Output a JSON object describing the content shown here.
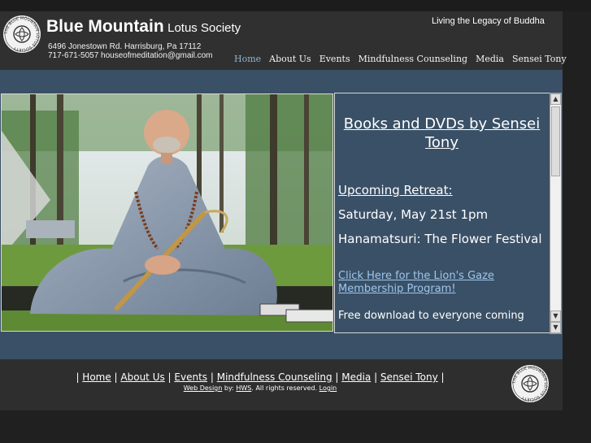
{
  "header": {
    "title_main": "Blue Mountain",
    "title_sub": "Lotus Society",
    "address_line": "6496 Jonestown Rd.  Harrisburg, Pa 17112",
    "contact_line": "717-671-5057   houseofmeditation@gmail.com",
    "tagline": "Living the Legacy of Buddha",
    "logo_text": "THE BLUE MOUNTAIN LOTUS SOCIETY"
  },
  "nav": {
    "items": [
      "Home",
      "About Us",
      "Events",
      "Mindfulness Counseling",
      "Media",
      "Sensei Tony"
    ],
    "active": "Home"
  },
  "panel": {
    "books_link": "Books and DVDs by Sensei Tony",
    "retreat_heading": "Upcoming Retreat:",
    "retreat_date": "Saturday, May 21st 1pm",
    "retreat_name": "Hanamatsuri:  The Flower Festival",
    "membership_link": "Click Here for the Lion's Gaze Membership Program!",
    "cutoff_text": "Free download to everyone coming"
  },
  "footer": {
    "nav_items": [
      "Home",
      "About Us",
      "Events",
      "Mindfulness Counseling",
      "Media",
      "Sensei Tony"
    ],
    "web_design_link": "Web Design",
    "by_text": "by:",
    "hws_link": "HWS",
    "rights_text": ". All rights reserved.",
    "login_link": "Login"
  },
  "colors": {
    "page_background": "#202020",
    "header_background": "#303030",
    "content_band": "#3a5066",
    "active_nav": "#8fb4d6",
    "link_blue": "#9ec6ee"
  },
  "icons": {
    "logo": "lotus-society-seal-icon",
    "scroll_up": "scroll-up-arrow-icon",
    "scroll_down": "scroll-down-arrow-icon"
  }
}
